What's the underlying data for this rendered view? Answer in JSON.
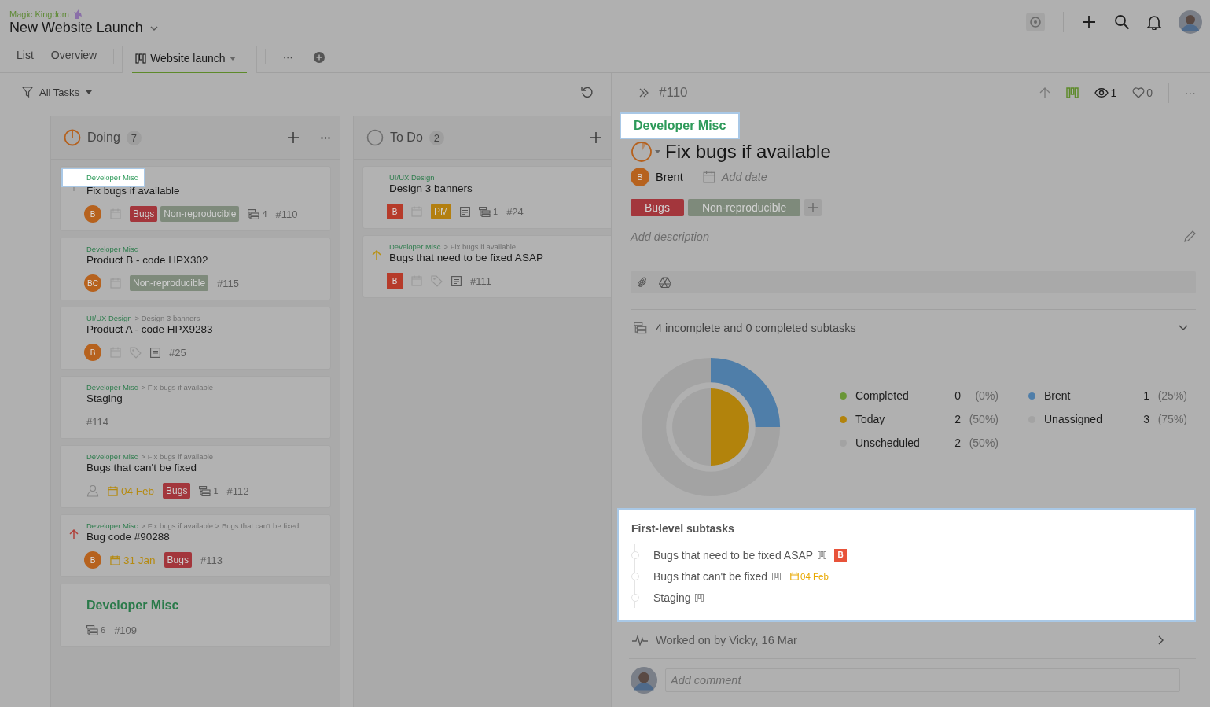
{
  "header": {
    "workspace": "Magic Kingdom",
    "project": "New Website Launch"
  },
  "tabs": [
    {
      "label": "List",
      "selected": false,
      "kind": "text"
    },
    {
      "label": "Overview",
      "selected": false,
      "kind": "text"
    },
    {
      "label": "Website launch",
      "selected": true,
      "kind": "board"
    }
  ],
  "tab_more": "···",
  "filter": {
    "label": "All Tasks"
  },
  "columns": [
    {
      "name": "Doing",
      "count": "7",
      "kind": "in_progress",
      "more_menu": true,
      "cards": [
        {
          "kind": "task",
          "priority": {
            "kind": "low"
          },
          "project": "Developer Misc",
          "spotlight": true,
          "title": "Fix bugs if available",
          "assignee": {
            "kind": "circle",
            "initials": "B"
          },
          "calendar": true,
          "tags": [
            {
              "label": "Bugs",
              "color": "#a3363c"
            },
            {
              "label": "Non-reproducible",
              "color": "#7e8a7b"
            }
          ],
          "subtasks": "4",
          "id": "#110"
        },
        {
          "kind": "task",
          "project": "Developer Misc",
          "title": "Product B - code HPX302",
          "assignee": {
            "kind": "circle",
            "initials": "BC"
          },
          "calendar": true,
          "tags": [
            {
              "label": "Non-reproducible",
              "color": "#7e8a7b"
            }
          ],
          "id": "#115"
        },
        {
          "kind": "task",
          "project": "UI/UX Design",
          "path": "> Design 3 banners",
          "title": "Product A - code HPX9283",
          "assignee": {
            "kind": "circle",
            "initials": "B"
          },
          "calendar": true,
          "label_icon": true,
          "notes": true,
          "id": "#25"
        },
        {
          "kind": "task",
          "project": "Developer Misc",
          "path": "> Fix bugs if available",
          "title": "Staging",
          "id": "#114"
        },
        {
          "kind": "task",
          "project": "Developer Misc",
          "path": "> Fix bugs if available",
          "title": "Bugs that can't be fixed",
          "assignee": {
            "kind": "none"
          },
          "due": "04 Feb",
          "tags": [
            {
              "label": "Bugs",
              "color": "#a3363c"
            }
          ],
          "subtasks": "1",
          "id": "#112"
        },
        {
          "kind": "task",
          "priority": {
            "kind": "high"
          },
          "project": "Developer Misc",
          "path": "> Fix bugs if available > Bugs that can't be fixed",
          "title": "Bug code #90288",
          "assignee": {
            "kind": "circle",
            "initials": "B"
          },
          "due": "31 Jan",
          "tags": [
            {
              "label": "Bugs",
              "color": "#a3363c"
            }
          ],
          "id": "#113"
        },
        {
          "kind": "project",
          "title": "Developer Misc",
          "subtasks": "6",
          "id": "#109"
        }
      ]
    },
    {
      "name": "To Do",
      "count": "2",
      "kind": "open",
      "cards": [
        {
          "kind": "task",
          "project": "UI/UX Design",
          "title": "Design 3 banners",
          "assignee": {
            "kind": "square",
            "initials": "B"
          },
          "calendar": true,
          "tags": [
            {
              "label": "PM",
              "color": "#b37f10"
            }
          ],
          "notes": true,
          "subtasks": "1",
          "id": "#24"
        },
        {
          "kind": "task",
          "priority": {
            "kind": "medium"
          },
          "project": "Developer Misc",
          "path": "> Fix bugs if available",
          "title": "Bugs that need to be fixed ASAP",
          "assignee": {
            "kind": "square",
            "initials": "B"
          },
          "calendar": true,
          "label_icon": true,
          "notes": true,
          "id": "#111"
        }
      ]
    }
  ],
  "panel": {
    "id": "#110",
    "watchers": "1",
    "likes": "0",
    "more": "···",
    "project": "Developer Misc",
    "title": "Fix bugs if available",
    "assignee": {
      "initials": "B",
      "name": "Brent"
    },
    "date_placeholder": "Add date",
    "tags": [
      {
        "label": "Bugs",
        "color": "#a3363c"
      },
      {
        "label": "Non-reproducible",
        "color": "#7e8a7b"
      }
    ],
    "description_placeholder": "Add description",
    "subtask_summary": "4 incomplete and 0 completed subtasks",
    "chart_data": {
      "type": "donut",
      "series": [
        {
          "colors": [
            "#6a9636",
            "#b2830c",
            "#a3a3a3"
          ],
          "values": [
            0,
            50,
            50
          ]
        },
        {
          "colors": [
            "#4f7ea9",
            "#a3a3a3"
          ],
          "values": [
            25,
            75
          ]
        }
      ]
    },
    "legend": [
      [
        {
          "label": "Completed",
          "count": "0",
          "percent": "(0%)"
        },
        {
          "label": "Today",
          "count": "2",
          "percent": "(50%)"
        },
        {
          "label": "Unscheduled",
          "count": "2",
          "percent": "(50%)"
        }
      ],
      [
        {
          "label": "Brent",
          "count": "1",
          "percent": "(25%)"
        },
        {
          "label": "Unassigned",
          "count": "3",
          "percent": "(75%)"
        }
      ]
    ],
    "first_level": {
      "heading": "First-level subtasks",
      "items": [
        {
          "title": "Bugs that need to be fixed ASAP",
          "assignee": "B"
        },
        {
          "title": "Bugs that can't be fixed",
          "due": "04 Feb"
        },
        {
          "title": "Staging"
        }
      ]
    },
    "activity": "Worked on by Vicky, 16 Mar",
    "comment_placeholder": "Add comment"
  }
}
